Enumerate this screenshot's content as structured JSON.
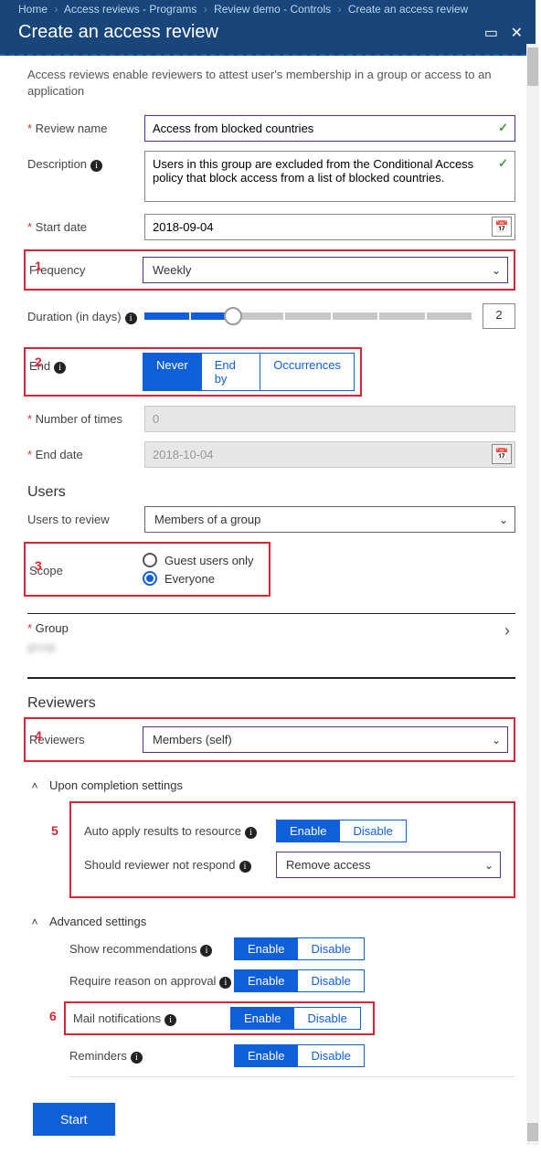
{
  "breadcrumb": {
    "home": "Home",
    "programs": "Access reviews - Programs",
    "demo": "Review demo - Controls",
    "current": "Create an access review"
  },
  "header": {
    "title": "Create an access review"
  },
  "intro": "Access reviews enable reviewers to attest user's membership in a group or access to an application",
  "labels": {
    "reviewName": "Review name",
    "description": "Description",
    "startDate": "Start date",
    "frequency": "Frequency",
    "duration": "Duration (in days)",
    "end": "End",
    "numberOfTimes": "Number of times",
    "endDate": "End date",
    "users": "Users",
    "usersToReview": "Users to review",
    "scope": "Scope",
    "group": "Group",
    "reviewers": "Reviewers",
    "reviewersField": "Reviewers"
  },
  "values": {
    "reviewName": "Access from blocked countries",
    "description": "Users in this group are excluded from the Conditional Access policy that block access from a list of blocked countries.",
    "startDate": "2018-09-04",
    "frequency": "Weekly",
    "durationDays": "2",
    "end": {
      "never": "Never",
      "endBy": "End by",
      "occurrences": "Occurrences",
      "selected": "Never"
    },
    "numberOfTimes": "0",
    "endDate": "2018-10-04",
    "usersToReview": "Members of a group",
    "scope": {
      "guest": "Guest users only",
      "everyone": "Everyone"
    },
    "groupPlaceholder": "group",
    "reviewers": "Members (self)"
  },
  "completion": {
    "header": "Upon completion settings",
    "autoApply": "Auto apply results to resource",
    "noRespond": "Should reviewer not respond",
    "noRespondValue": "Remove access"
  },
  "advanced": {
    "header": "Advanced settings",
    "showRec": "Show recommendations",
    "requireReason": "Require reason on approval",
    "mail": "Mail notifications",
    "reminders": "Reminders"
  },
  "toggle": {
    "enable": "Enable",
    "disable": "Disable"
  },
  "startButton": "Start",
  "annotations": {
    "n1": "1",
    "n2": "2",
    "n3": "3",
    "n4": "4",
    "n5": "5",
    "n6": "6"
  }
}
